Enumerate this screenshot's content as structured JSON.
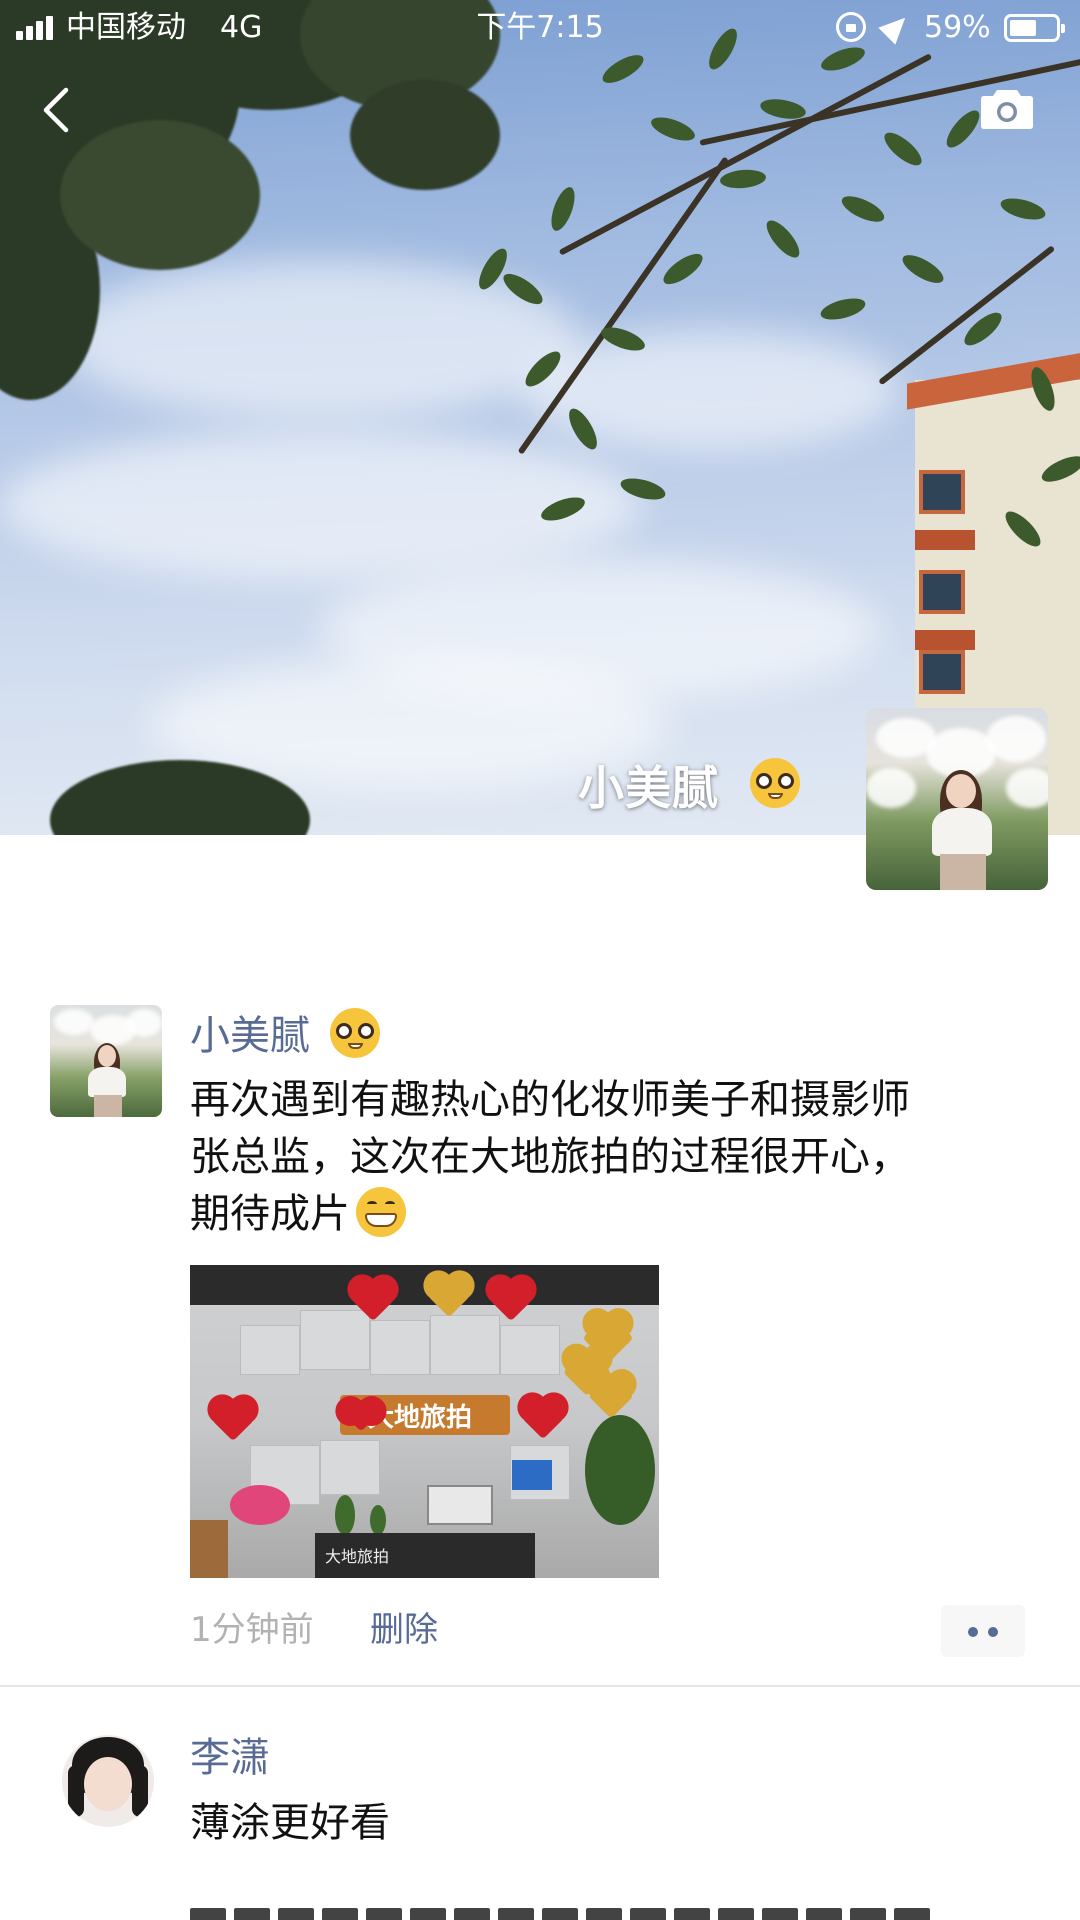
{
  "status_bar": {
    "carrier": "中国移动",
    "network": "4G",
    "time": "下午7:15",
    "battery_percent": "59%",
    "battery_level": 0.59
  },
  "nav": {
    "back_icon": "chevron-left-icon",
    "camera_icon": "camera-icon"
  },
  "cover": {
    "display_name": "小美腻",
    "name_emoji": "nerd-face-emoji"
  },
  "posts": [
    {
      "author": "小美腻",
      "author_emoji": "nerd-face-emoji",
      "text_lines": [
        "再次遇到有趣热心的化妆师美子和摄影师",
        "张总监，这次在大地旅拍的过程很开心，",
        "期待成片"
      ],
      "text_emoji": "grinning-face-emoji",
      "image": {
        "sign_text": "大地旅拍",
        "desk_text": "大地旅拍"
      },
      "time": "1分钟前",
      "delete_label": "删除",
      "more_icon": "more-dots-icon"
    },
    {
      "author": "李潇",
      "text_lines": [
        "薄涂更好看"
      ]
    }
  ],
  "colors": {
    "link": "#576b95",
    "meta": "#b2b2b2",
    "divider": "#e7e7e7"
  }
}
